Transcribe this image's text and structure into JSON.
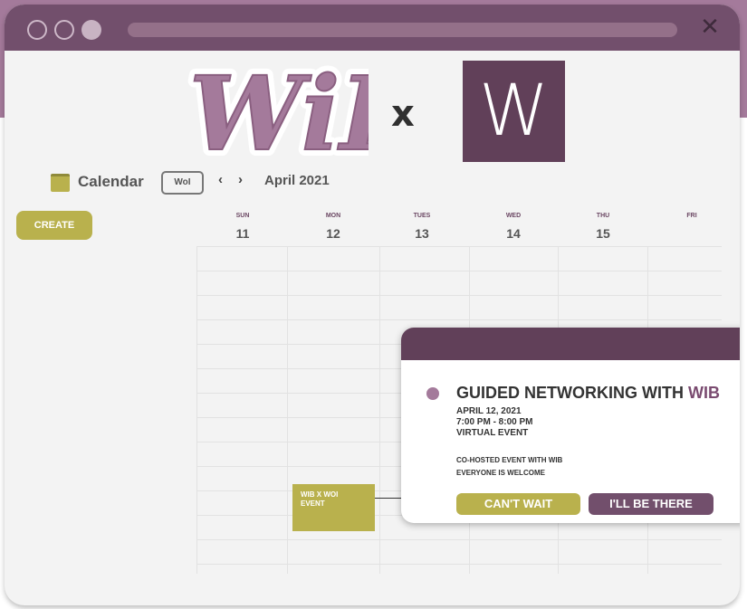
{
  "window": {
    "close_glyph": "✕"
  },
  "logos": {
    "wib": "WiB",
    "x": "x",
    "woi": "W"
  },
  "calendar": {
    "icon": "calendar-icon",
    "title": "Calendar",
    "view_button": "WoI",
    "prev_glyph": "‹",
    "next_glyph": "›",
    "month": "April 2021",
    "create_button": "CREATE",
    "days": [
      {
        "name": "SUN",
        "num": "11"
      },
      {
        "name": "MON",
        "num": "12"
      },
      {
        "name": "TUES",
        "num": "13"
      },
      {
        "name": "WED",
        "num": "14"
      },
      {
        "name": "THU",
        "num": "15"
      },
      {
        "name": "FRI",
        "num": ""
      }
    ]
  },
  "event": {
    "line1": "WIB X WOI",
    "line2": "EVENT"
  },
  "popup": {
    "title_main": "GUIDED NETWORKING WITH ",
    "title_accent": "WIB",
    "date": "APRIL 12, 2021",
    "time": "7:00 PM - 8:00 PM",
    "location": "VIRTUAL EVENT",
    "note1": "CO-HOSTED EVENT WITH WIB",
    "note2": "EVERYONE IS WELCOME",
    "btn_wait": "CAN'T WAIT",
    "btn_there": "I'LL BE THERE"
  },
  "colors": {
    "purple": "#724f6c",
    "dark_purple": "#614059",
    "mauve": "#a47a9b",
    "olive": "#b9b14d"
  }
}
